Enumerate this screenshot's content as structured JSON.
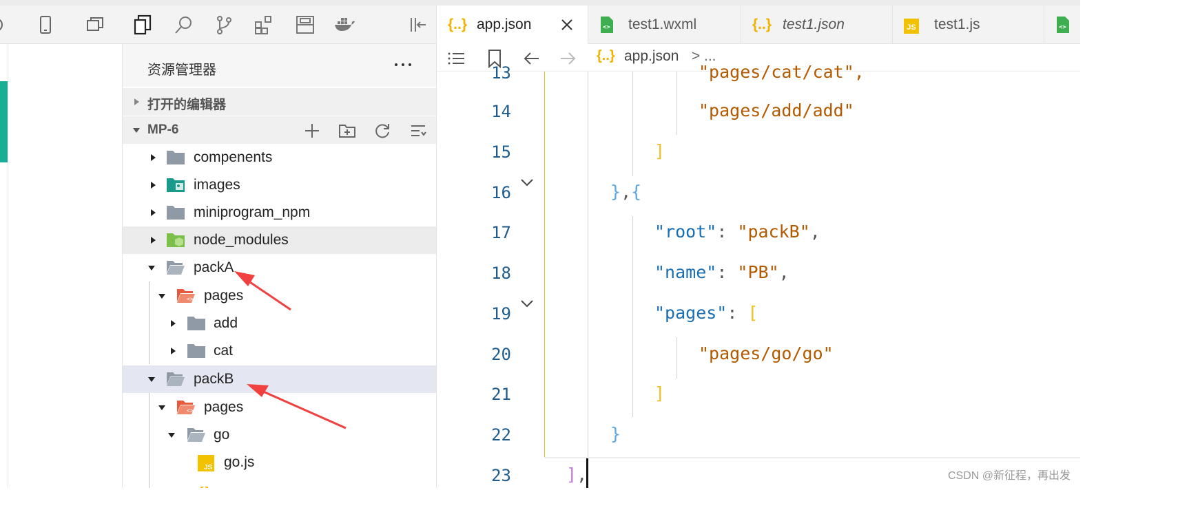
{
  "explorer": {
    "title": "资源管理器",
    "open_editors_label": "打开的编辑器",
    "project_label": "MP-6",
    "tree": [
      {
        "name": "compenents"
      },
      {
        "name": "images"
      },
      {
        "name": "miniprogram_npm"
      },
      {
        "name": "node_modules"
      },
      {
        "name": "packA"
      },
      {
        "name": "pages"
      },
      {
        "name": "add"
      },
      {
        "name": "cat"
      },
      {
        "name": "packB"
      },
      {
        "name": "pages"
      },
      {
        "name": "go"
      },
      {
        "name": "go.js"
      }
    ]
  },
  "tabs": [
    {
      "label": "app.json",
      "icon": "json-icon",
      "active": true
    },
    {
      "label": "test1.wxml",
      "icon": "wxml-icon",
      "active": false
    },
    {
      "label": "test1.json",
      "icon": "json-icon",
      "active": false
    },
    {
      "label": "test1.js",
      "icon": "js-icon",
      "active": false
    }
  ],
  "tab_icons": {
    "json": "{..}",
    "js": "JS"
  },
  "breadcrumb": {
    "file": "app.json",
    "separator": ">",
    "ellipsis": "..."
  },
  "code": {
    "line_numbers": [
      "13",
      "14",
      "15",
      "16",
      "17",
      "18",
      "19",
      "20",
      "21",
      "22",
      "23"
    ],
    "line13_text": "\"pages/cat/cat\",",
    "line14_text": "\"pages/add/add\"",
    "line15_text": "]",
    "line16_close": "}",
    "line16_comma": ",",
    "line16_open": "{",
    "line17_key": "\"root\"",
    "line17_sep": ": ",
    "line17_value": "\"packB\"",
    "line17_comma": ",",
    "line18_key": "\"name\"",
    "line18_sep": ": ",
    "line18_value": "\"PB\"",
    "line18_comma": ",",
    "line19_key": "\"pages\"",
    "line19_sep": ": ",
    "line19_bracket": "[",
    "line20_text": "\"pages/go/go\"",
    "line21_text": "]",
    "line22_text": "}",
    "line23_bracket": "]",
    "line23_comma": ","
  },
  "watermark": "CSDN @新征程，再出发",
  "colors": {
    "accent": "#1aad96",
    "string": "#b35a00",
    "key": "#1a6fb3",
    "arrow": "#f04040"
  }
}
